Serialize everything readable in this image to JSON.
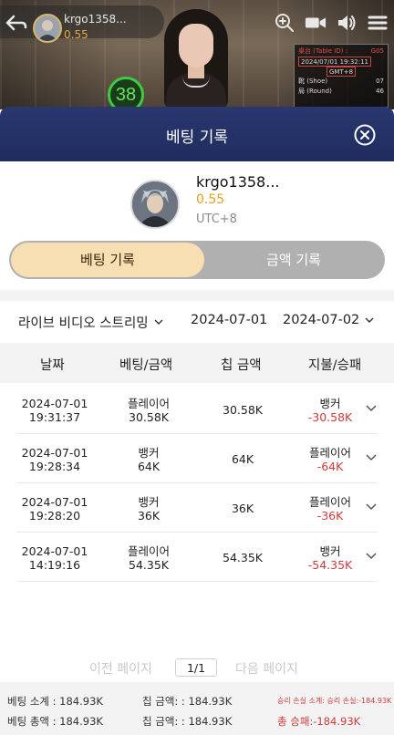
{
  "header": {
    "username": "krgo1358...",
    "balance": "0.55",
    "timer": "38"
  },
  "table_info": {
    "rows": [
      {
        "label": "桌台 (Table ID) :",
        "value": "G05"
      },
      {
        "label": "2024/07/01 19:32:11",
        "value": ""
      },
      {
        "label": "GMT+8",
        "value": ""
      },
      {
        "label": "靴 (Shoe)",
        "value": "07"
      },
      {
        "label": "局 (Round)",
        "value": "46"
      }
    ]
  },
  "modal": {
    "title": "베팅 기록"
  },
  "profile": {
    "name": "krgo1358...",
    "balance": "0.55",
    "timezone": "UTC+8"
  },
  "tabs": {
    "active": "베팅 기록",
    "inactive": "금액 기록"
  },
  "filters": {
    "game": "라이브 비디오 스트리밍",
    "start_date": "2024-07-01",
    "end_date": "2024-07-02"
  },
  "columns": [
    "날짜",
    "베팅/금액",
    "칩 금액",
    "지불/승패"
  ],
  "rows": [
    {
      "date": "2024-07-01",
      "time": "19:31:37",
      "bet_type": "플레이어",
      "bet_amount": "30.58K",
      "chip": "30.58K",
      "result": "뱅커",
      "win_loss": "-30.58K"
    },
    {
      "date": "2024-07-01",
      "time": "19:28:34",
      "bet_type": "뱅커",
      "bet_amount": "64K",
      "chip": "64K",
      "result": "플레이어",
      "win_loss": "-64K"
    },
    {
      "date": "2024-07-01",
      "time": "19:28:20",
      "bet_type": "뱅커",
      "bet_amount": "36K",
      "chip": "36K",
      "result": "플레이어",
      "win_loss": "-36K"
    },
    {
      "date": "2024-07-01",
      "time": "14:19:16",
      "bet_type": "플레이어",
      "bet_amount": "54.35K",
      "chip": "54.35K",
      "result": "뱅커",
      "win_loss": "-54.35K"
    }
  ],
  "pager": {
    "prev": "이전 페이지",
    "page": "1/1",
    "next": "다음 페이지"
  },
  "summary": {
    "bet_subtotal": "베팅 소계 : 184.93K",
    "chip_subtotal": "칩 금액: : 184.93K",
    "winloss_subtotal": "승리 손실 소계: 승리 손실:-184.93K",
    "bet_total": "베팅 총액 : 184.93K",
    "chip_total": "칩 금액: : 184.93K",
    "winloss_total": "총 승패:-184.93K"
  },
  "colors": {
    "header_bg": "#1f2c5e",
    "active_tab": "#f7dfb3",
    "balance": "#e0a21a",
    "loss": "#d23a3a"
  }
}
